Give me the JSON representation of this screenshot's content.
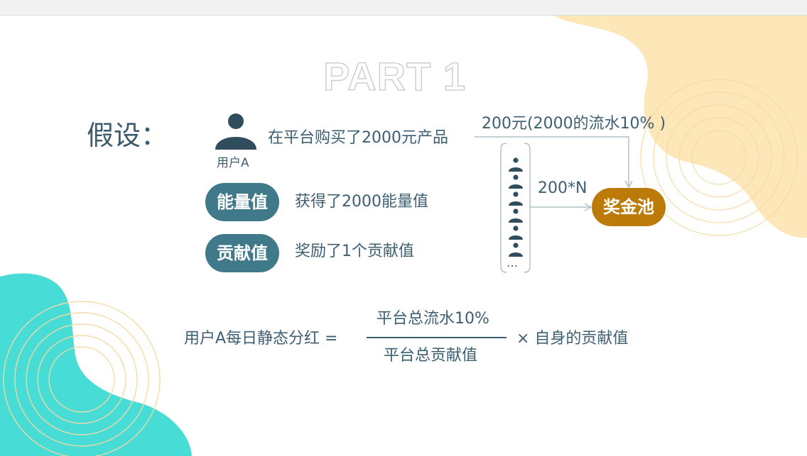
{
  "slide": {
    "part_title": "PART 1",
    "assumption_label": "假设：",
    "user_label": "用户A",
    "purchase_text": "在平台购买了2000元产品",
    "flow_top_text": "200元(2000的流水10% )",
    "flow_multi_text": "200*N",
    "pool_label": "奖金池",
    "energy": {
      "label": "能量值",
      "desc": "获得了2000能量值"
    },
    "contribution": {
      "label": "贡献值",
      "desc": "奖励了1个贡献值"
    },
    "ellipsis": "…",
    "formula": {
      "left": "用户A每日静态分红 =",
      "numerator": "平台总流水10%",
      "denominator": "平台总贡献值",
      "right": "× 自身的贡献值"
    }
  },
  "colors": {
    "text": "#3d5f72",
    "pill": "#40798a",
    "pool": "#bc7b09",
    "blob_teal": "#47dcd6",
    "blob_peach": "#fde6b8",
    "ring": "#f6d9a3"
  },
  "icons": [
    "user-icon",
    "person-icon"
  ]
}
